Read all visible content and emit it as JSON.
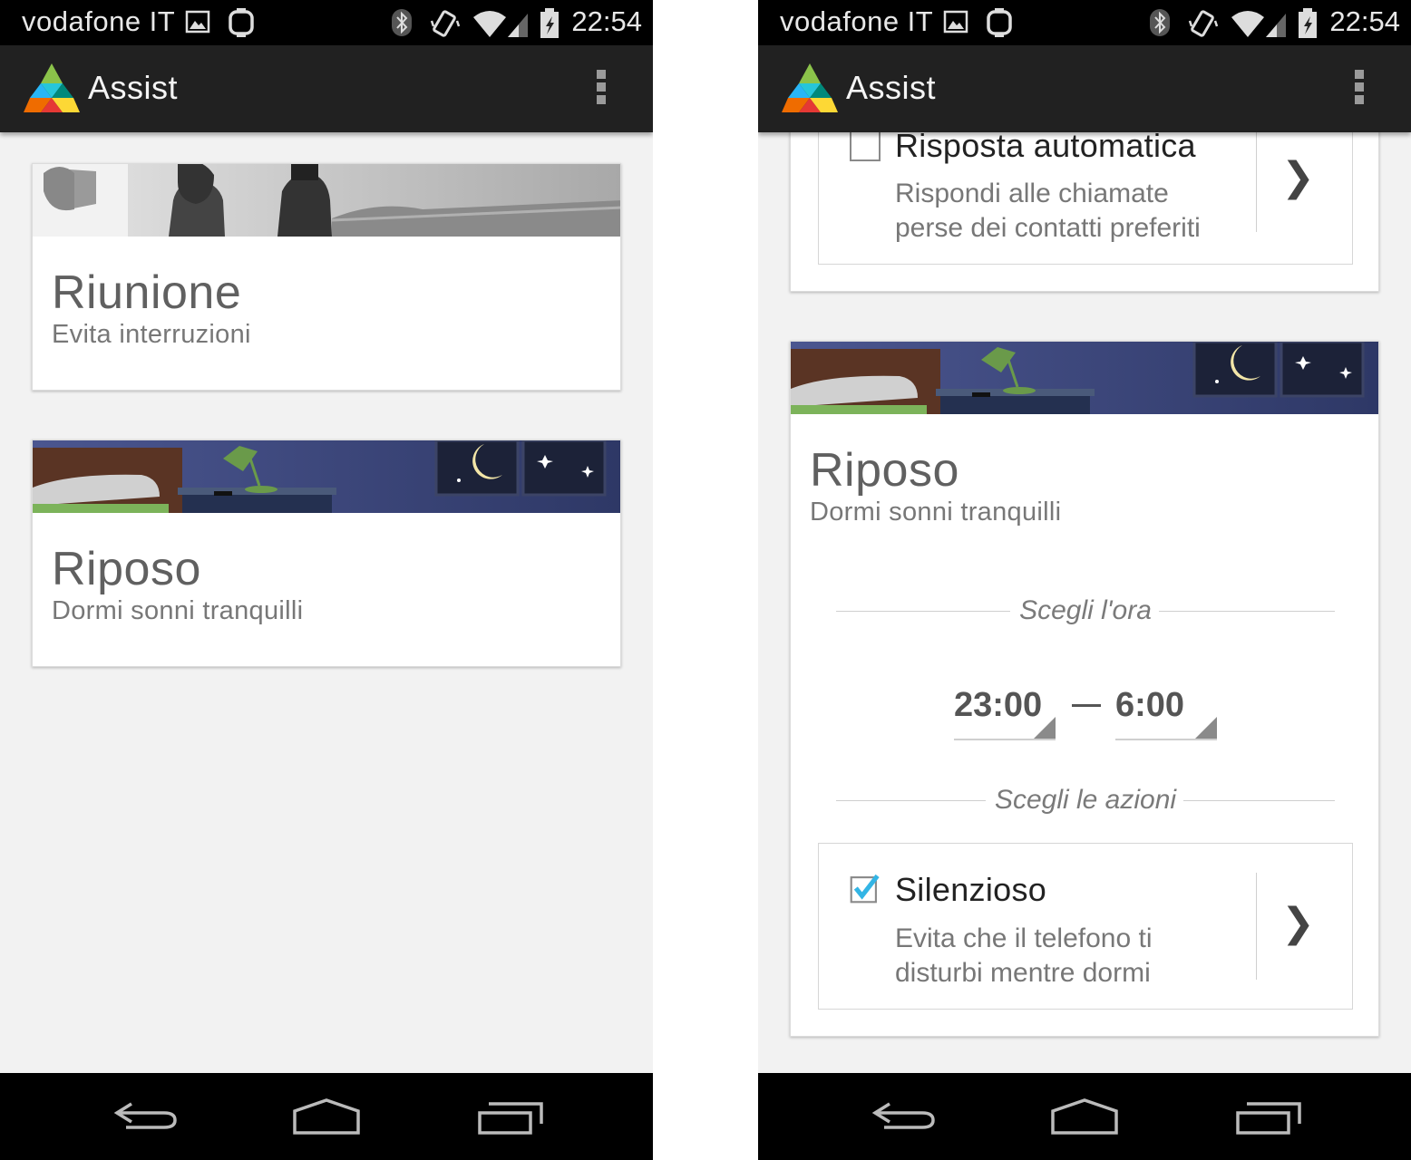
{
  "status_bar": {
    "carrier": "vodafone IT",
    "time": "22:54"
  },
  "action_bar": {
    "title": "Assist"
  },
  "left_screen": {
    "cards": [
      {
        "title": "Riunione",
        "subtitle": "Evita interruzioni"
      },
      {
        "title": "Riposo",
        "subtitle": "Dormi sonni tranquilli"
      }
    ]
  },
  "right_screen": {
    "auto_reply": {
      "title": "Risposta automatica",
      "description_line1": "Rispondi alle chiamate",
      "description_line2": "perse dei contatti preferiti",
      "checked": false
    },
    "card": {
      "title": "Riposo",
      "subtitle": "Dormi sonni tranquilli"
    },
    "time_section_label": "Scegli l'ora",
    "start_time": "23:00",
    "end_time": "6:00",
    "actions_section_label": "Scegli le azioni",
    "silent": {
      "title": "Silenzioso",
      "description_line1": "Evita che il telefono ti",
      "description_line2": "disturbi mentre dormi",
      "checked": true
    },
    "chevron": "❯"
  },
  "colors": {
    "action_bar": "#212121",
    "status_bar": "#000000",
    "background": "#f2f2f2",
    "checkbox_accent": "#33b5e5",
    "night_sky": "#3b4775"
  },
  "icons": [
    "gallery-icon",
    "watch-icon",
    "bluetooth-icon",
    "vibrate-icon",
    "wifi-icon",
    "signal-icon",
    "battery-icon",
    "app-logo-icon",
    "overflow-menu-icon",
    "back-icon",
    "home-icon",
    "recents-icon",
    "chevron-right-icon",
    "checkbox-icon"
  ]
}
